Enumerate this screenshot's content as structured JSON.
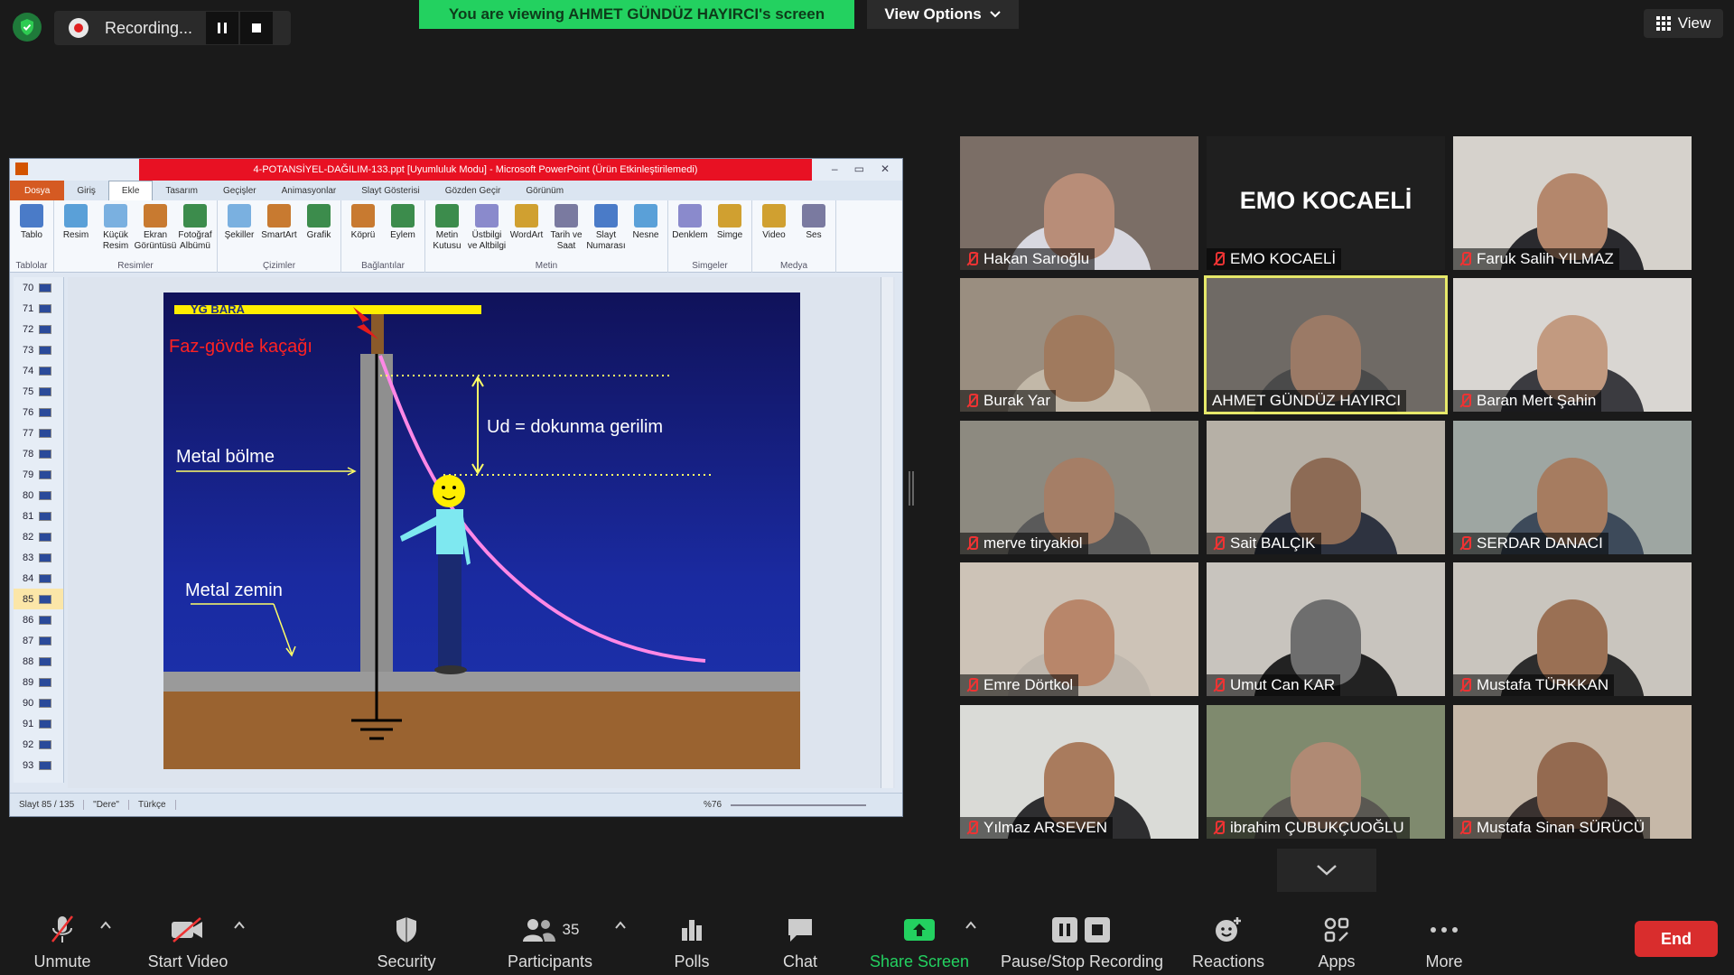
{
  "top": {
    "recording_label": "Recording...",
    "viewing_banner": "You are viewing AHMET GÜNDÜZ HAYIRCI's screen",
    "view_options_label": "View Options",
    "view_label": "View"
  },
  "ppt": {
    "title": "4-POTANSİYEL-DAĞILIM-133.ppt [Uyumluluk Modu] - Microsoft PowerPoint (Ürün Etkinleştirilemedi)",
    "tabs": [
      "Dosya",
      "Giriş",
      "Ekle",
      "Tasarım",
      "Geçişler",
      "Animasyonlar",
      "Slayt Gösterisi",
      "Gözden Geçir",
      "Görünüm"
    ],
    "ribbon_groups": [
      {
        "name": "Tablolar",
        "items": [
          "Tablo"
        ]
      },
      {
        "name": "Resimler",
        "items": [
          "Resim",
          "Küçük Resim",
          "Ekran Görüntüsü",
          "Fotoğraf Albümü"
        ]
      },
      {
        "name": "Çizimler",
        "items": [
          "Şekiller",
          "SmartArt",
          "Grafik"
        ]
      },
      {
        "name": "Bağlantılar",
        "items": [
          "Köprü",
          "Eylem"
        ]
      },
      {
        "name": "Metin",
        "items": [
          "Metin Kutusu",
          "Üstbilgi ve Altbilgi",
          "WordArt",
          "Tarih ve Saat",
          "Slayt Numarası",
          "Nesne"
        ]
      },
      {
        "name": "Simgeler",
        "items": [
          "Denklem",
          "Simge"
        ]
      },
      {
        "name": "Medya",
        "items": [
          "Video",
          "Ses"
        ]
      }
    ],
    "thumbnails": [
      "70",
      "71",
      "72",
      "73",
      "74",
      "75",
      "76",
      "77",
      "78",
      "79",
      "80",
      "81",
      "82",
      "83",
      "84",
      "85",
      "86",
      "87",
      "88",
      "89",
      "90",
      "91",
      "92",
      "93"
    ],
    "selected_thumbnail": "85",
    "status": {
      "slide": "Slayt 85 / 135",
      "theme": "\"Dere\"",
      "language": "Türkçe",
      "zoom": "%76"
    }
  },
  "slide": {
    "bus_label": "YG BARA",
    "fault_label": "Faz-gövde kaçağı",
    "ud_label": "Ud = dokunma gerilim",
    "wall_label": "Metal bölme",
    "floor_label": "Metal zemin"
  },
  "participants": [
    {
      "name": "Hakan Sarıoğlu",
      "skin": "#b88d78",
      "bg": "#7b6e66",
      "shirt": "#d8d8e0"
    },
    {
      "name": "EMO KOCAELİ",
      "skin": "",
      "bg": "#1f1f1f",
      "shirt": "",
      "text": "EMO KOCAELİ"
    },
    {
      "name": "Faruk Salih YILMAZ",
      "skin": "#b4876c",
      "bg": "#d6d2cc",
      "shirt": "#2a2a2e"
    },
    {
      "name": "Burak Yar",
      "skin": "#a07a5e",
      "bg": "#9a8e80",
      "shirt": "#c2b8a8"
    },
    {
      "name": "AHMET GÜNDÜZ HAYIRCI",
      "skin": "#9b7a66",
      "bg": "#6f6a65",
      "shirt": "#4a4a4a",
      "active": true
    },
    {
      "name": "Baran Mert Şahin",
      "skin": "#c29a80",
      "bg": "#d9d6d2",
      "shirt": "#3b3b40"
    },
    {
      "name": "merve tiryakiol",
      "skin": "#a57e66",
      "bg": "#8d8a80",
      "shirt": "#5a5a5a"
    },
    {
      "name": "Sait BALÇIK",
      "skin": "#8d6b55",
      "bg": "#b6b0a6",
      "shirt": "#2e3340"
    },
    {
      "name": "SERDAR DANACI",
      "skin": "#a67c60",
      "bg": "#9ea6a2",
      "shirt": "#3d4a5a"
    },
    {
      "name": "Emre Dörtkol",
      "skin": "#b8866a",
      "bg": "#cdc3b7",
      "shirt": "#bfb7ad"
    },
    {
      "name": "Umut Can KAR",
      "skin": "#6e6e6e",
      "bg": "#c8c4be",
      "shirt": "#222"
    },
    {
      "name": "Mustafa TÜRKKAN",
      "skin": "#9a7054",
      "bg": "#c9c5be",
      "shirt": "#2c2c2c"
    },
    {
      "name": "Yılmaz ARSEVEN",
      "skin": "#a97b5d",
      "bg": "#dadbd7",
      "shirt": "#2e2e30"
    },
    {
      "name": "ibrahim ÇUBUKÇUOĞLU",
      "skin": "#b08a74",
      "bg": "#7f8a6e",
      "shirt": "#5a5852"
    },
    {
      "name": "Mustafa Sinan SÜRÜCÜ",
      "skin": "#946a50",
      "bg": "#c6b8a8",
      "shirt": "#3a3230"
    }
  ],
  "toolbar": {
    "unmute": "Unmute",
    "start_video": "Start Video",
    "security": "Security",
    "participants": "Participants",
    "participants_count": "35",
    "polls": "Polls",
    "chat": "Chat",
    "share_screen": "Share Screen",
    "pause_stop": "Pause/Stop Recording",
    "reactions": "Reactions",
    "apps": "Apps",
    "more": "More",
    "end": "End"
  },
  "colors": {
    "green": "#23d160",
    "end_red": "#d92d2d",
    "active_outline": "#e6e86a",
    "slide_bg": "#1a2a9a"
  }
}
